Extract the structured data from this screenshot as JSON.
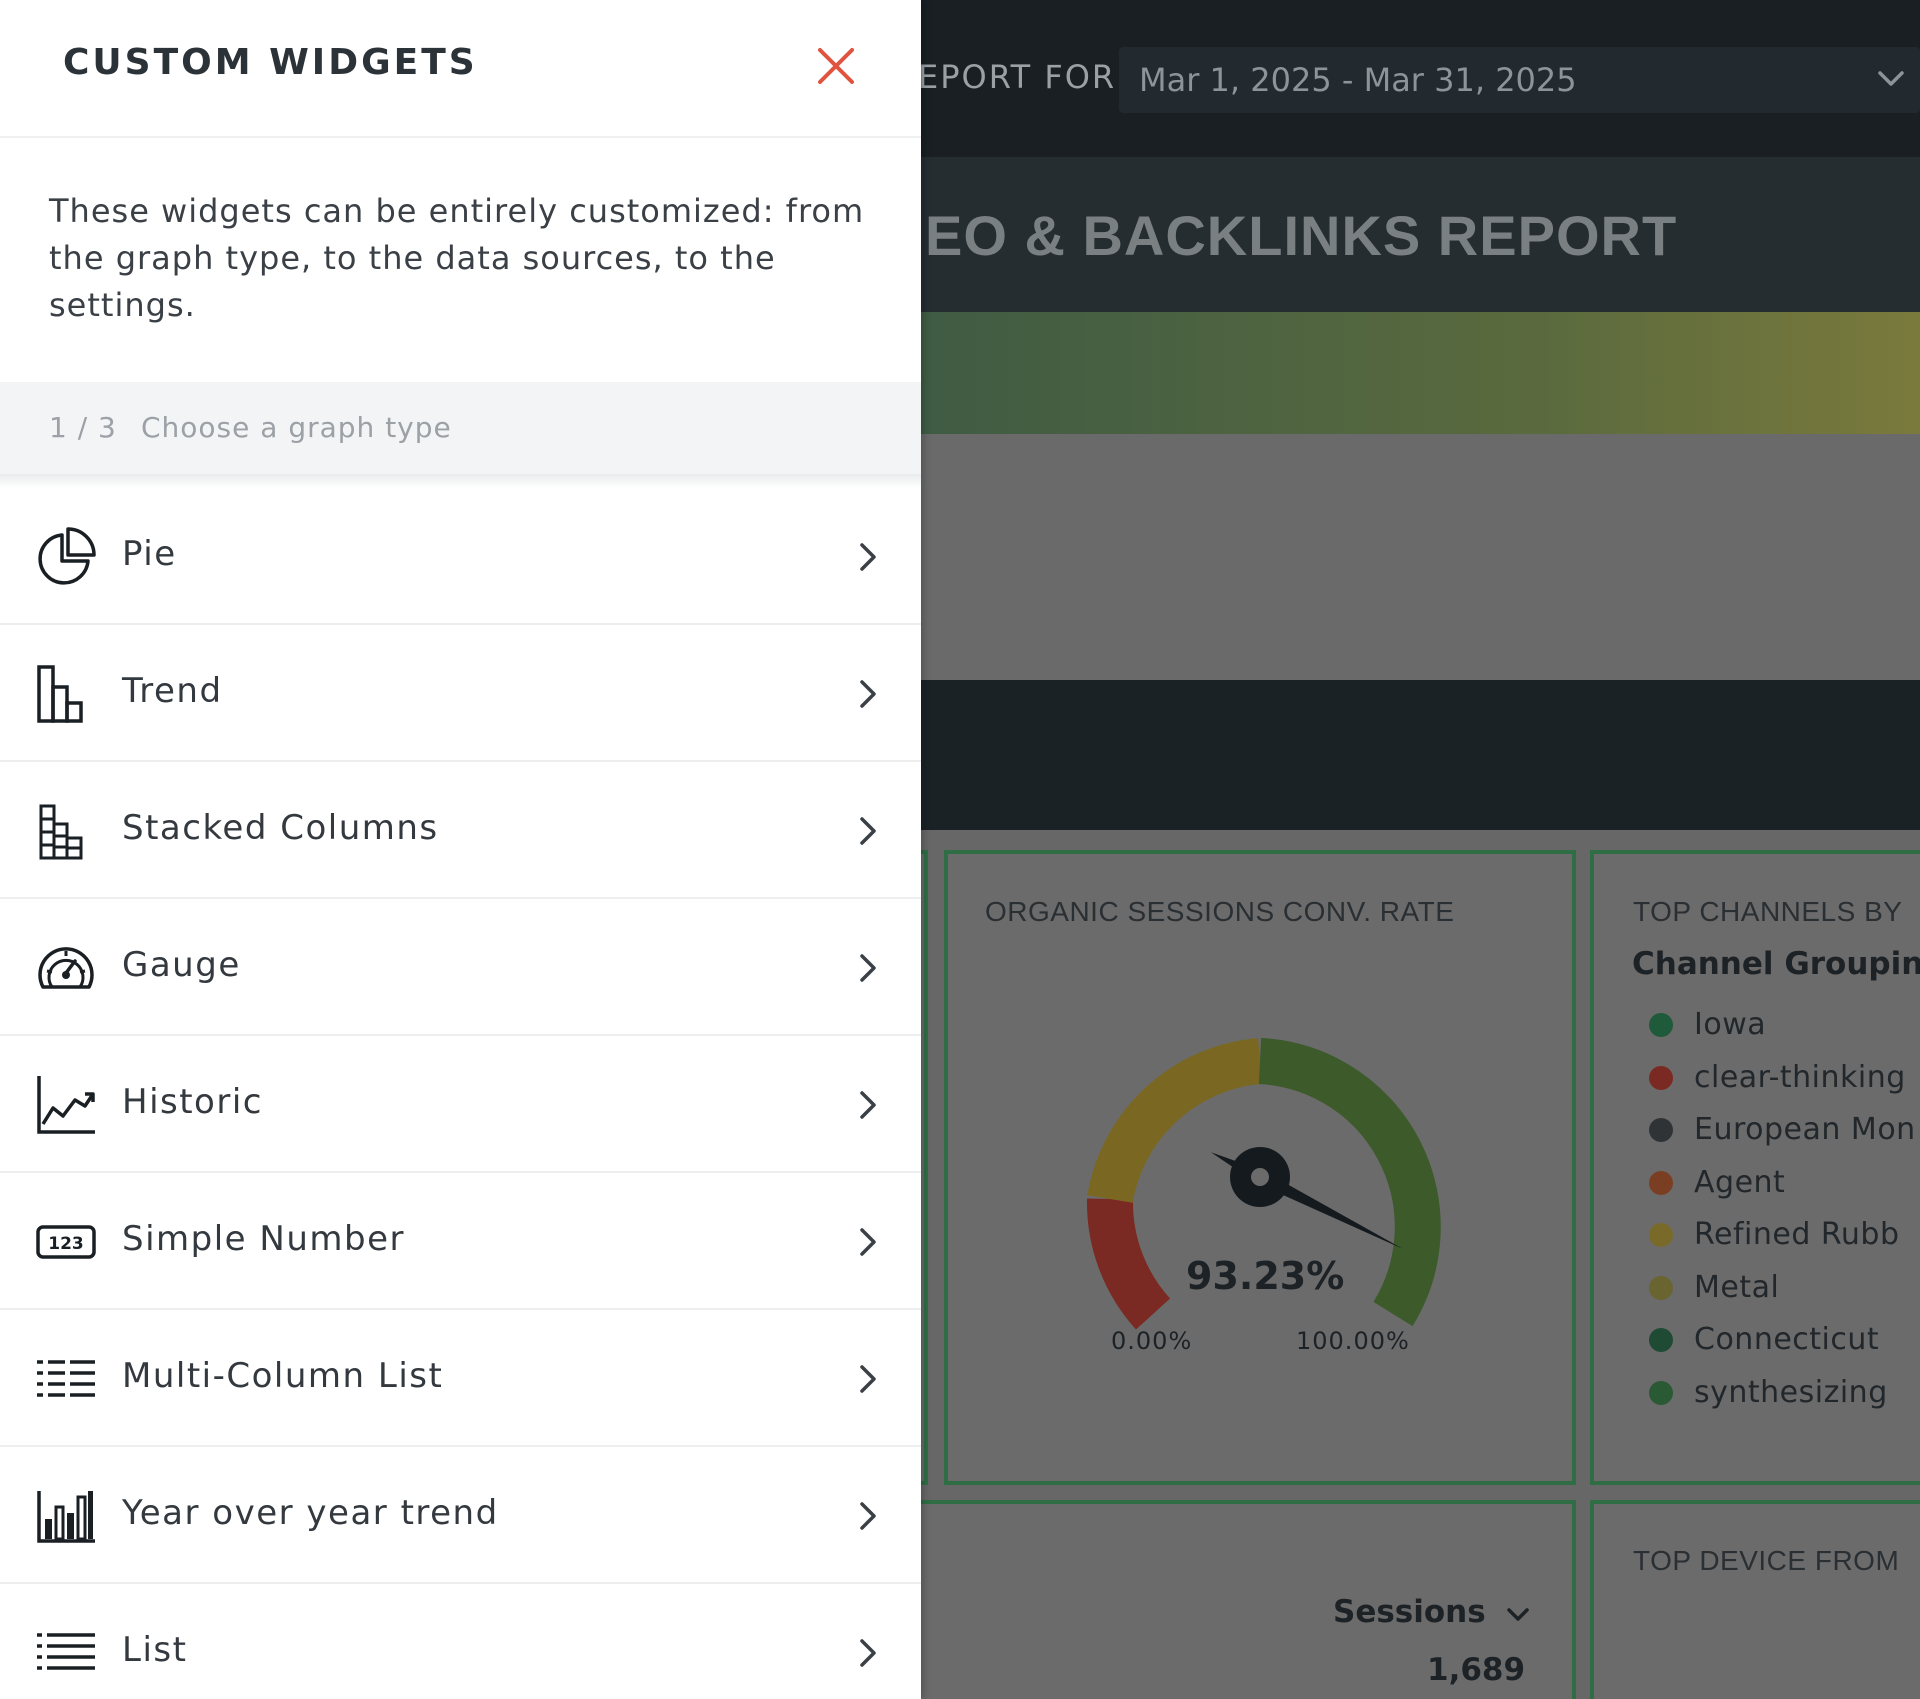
{
  "panel": {
    "title": "CUSTOM WIDGETS",
    "description": "These widgets can be entirely customized: from the graph type, to the data sources, to the settings.",
    "step": {
      "counter": "1 / 3",
      "label": "Choose a graph type"
    },
    "graph_types": [
      {
        "label": "Pie",
        "icon": "pie-chart-icon"
      },
      {
        "label": "Trend",
        "icon": "bar-chart-icon"
      },
      {
        "label": "Stacked Columns",
        "icon": "stacked-columns-icon"
      },
      {
        "label": "Gauge",
        "icon": "gauge-icon"
      },
      {
        "label": "Historic",
        "icon": "line-chart-icon"
      },
      {
        "label": "Simple Number",
        "icon": "number-123-icon"
      },
      {
        "label": "Multi-Column List",
        "icon": "multi-column-list-icon"
      },
      {
        "label": "Year over year trend",
        "icon": "year-bar-chart-icon"
      },
      {
        "label": "List",
        "icon": "list-icon"
      }
    ],
    "close_color": "#e0533f"
  },
  "report": {
    "report_for_label": "EPORT FOR",
    "date_range": "Mar 1, 2025 - Mar 31, 2025",
    "title": "EO & BACKLINKS REPORT",
    "gauge_card": {
      "title": "ORGANIC SESSIONS CONV. RATE",
      "value": "93.23%",
      "value_fraction": 0.9323,
      "min": "0.00%",
      "max": "100.00%"
    },
    "channels_card": {
      "title": "TOP CHANNELS BY",
      "heading": "Channel Groupin",
      "items": [
        {
          "label": "Iowa",
          "color": "#1f5a3a"
        },
        {
          "label": "clear-thinking",
          "color": "#7a2a22"
        },
        {
          "label": "European Mon",
          "color": "#2f3336"
        },
        {
          "label": "Agent",
          "color": "#7a3f22"
        },
        {
          "label": "Refined Rubb",
          "color": "#7a6a2a"
        },
        {
          "label": "Metal",
          "color": "#6a6430"
        },
        {
          "label": "Connecticut",
          "color": "#1f4a34"
        },
        {
          "label": "synthesizing",
          "color": "#2a5a34"
        }
      ]
    },
    "device_card": {
      "title": "TOP DEVICE FROM"
    },
    "sessions": {
      "label": "Sessions",
      "value": "1,689"
    }
  }
}
